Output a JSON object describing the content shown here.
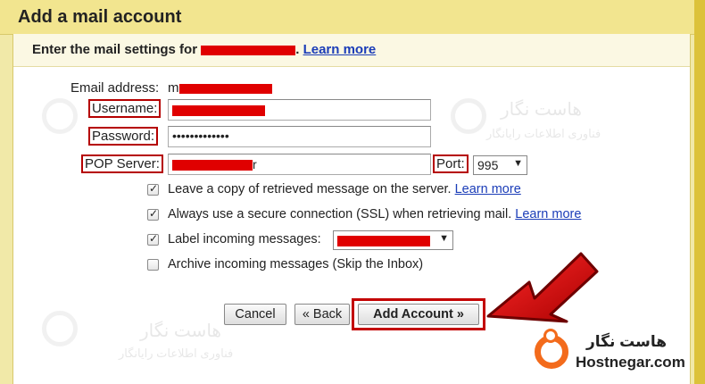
{
  "dialog": {
    "title": "Add a mail account",
    "subtitle_prefix": "Enter the mail settings for",
    "learn_more": "Learn more"
  },
  "form": {
    "email_label": "Email address:",
    "email_prefix": "m",
    "username_label": "Username:",
    "password_label": "Password:",
    "password_value": "•••••••••••••",
    "pop_label": "POP Server:",
    "pop_suffix": "r",
    "port_label": "Port:",
    "port_value": "995"
  },
  "options": [
    {
      "label": "Leave a copy of retrieved message on the server.",
      "checked": true,
      "link": "Learn more"
    },
    {
      "label": "Always use a secure connection (SSL) when retrieving mail.",
      "checked": true,
      "link": "Learn more"
    },
    {
      "label": "Label incoming messages:",
      "checked": true
    },
    {
      "label": "Archive incoming messages (Skip the Inbox)",
      "checked": false
    }
  ],
  "buttons": {
    "cancel": "Cancel",
    "back": "« Back",
    "add_account": "Add Account »"
  },
  "brand": {
    "fa": "هاست نگار",
    "fa_sub": "فناوری اطلاعات رایانگار",
    "en": "Hostnegar.com",
    "accent": "#f36b1c"
  },
  "colors": {
    "highlight_red": "#c30000",
    "redaction": "#e00000",
    "link": "#1b3db8"
  }
}
